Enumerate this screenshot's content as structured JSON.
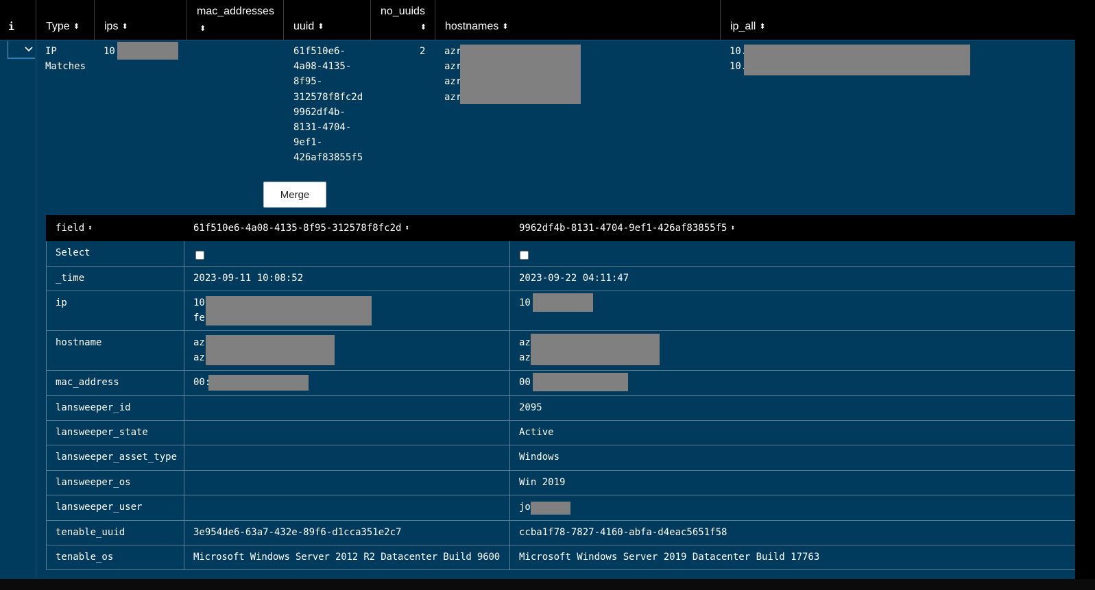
{
  "header": {
    "info_icon": "i",
    "columns": {
      "type": "Type",
      "ips": "ips",
      "mac_addresses": "mac_addresses",
      "uuid": "uuid",
      "no_uuids": "no_uuids",
      "hostnames": "hostnames",
      "ip_all": "ip_all"
    },
    "sort_icon": "⬍"
  },
  "row": {
    "type_line1": "IP",
    "type_line2": "Matches",
    "ips": "10",
    "uuid_lines": [
      "61f510e6-",
      "4a08-4135-",
      "8f95-",
      "312578f8fc2d",
      "9962df4b-",
      "8131-4704-",
      "9ef1-",
      "426af83855f5"
    ],
    "no_uuids": "2",
    "hostnames": [
      "azr",
      "azr",
      "azr",
      "azr"
    ],
    "ip_all": [
      "10.",
      "10."
    ],
    "merge_label": "Merge"
  },
  "compare": {
    "headers": {
      "field": "field",
      "uuid_a": "61f510e6-4a08-4135-8f95-312578f8fc2d",
      "uuid_b": "9962df4b-8131-4704-9ef1-426af83855f5"
    },
    "rows": {
      "select": {
        "field": "Select"
      },
      "time": {
        "field": "_time",
        "a": "2023-09-11 10:08:52",
        "b": "2023-09-22 04:11:47"
      },
      "ip": {
        "field": "ip",
        "a1": "10",
        "a2": "fe",
        "b1": "10"
      },
      "hostname": {
        "field": "hostname",
        "a1": "az",
        "a2": "az",
        "b1": "az",
        "b2": "az"
      },
      "mac_address": {
        "field": "mac_address",
        "a": "00:",
        "b": "00"
      },
      "lansweeper_id": {
        "field": "lansweeper_id",
        "a": "",
        "b": "2095"
      },
      "lansweeper_state": {
        "field": "lansweeper_state",
        "a": "",
        "b": "Active"
      },
      "lansweeper_asset_type": {
        "field": "lansweeper_asset_type",
        "a": "",
        "b": "Windows"
      },
      "lansweeper_os": {
        "field": "lansweeper_os",
        "a": "",
        "b": "Win 2019"
      },
      "lansweeper_user": {
        "field": "lansweeper_user",
        "a": "",
        "b": "jo"
      },
      "tenable_uuid": {
        "field": "tenable_uuid",
        "a": "3e954de6-63a7-432e-89f6-d1cca351e2c7",
        "b": "ccba1f78-7827-4160-abfa-d4eac5651f58"
      },
      "tenable_os": {
        "field": "tenable_os",
        "a": "Microsoft Windows Server 2012 R2 Datacenter Build 9600",
        "b": "Microsoft Windows Server 2019 Datacenter Build 17763"
      }
    }
  },
  "colors": {
    "row_bg": "#003a5c",
    "header_bg": "#000000",
    "redaction": "#808080",
    "border": "#5c7e96"
  },
  "icons": {
    "info": "info-icon",
    "expand": "chevron-down-icon",
    "sort": "sort-icon"
  }
}
